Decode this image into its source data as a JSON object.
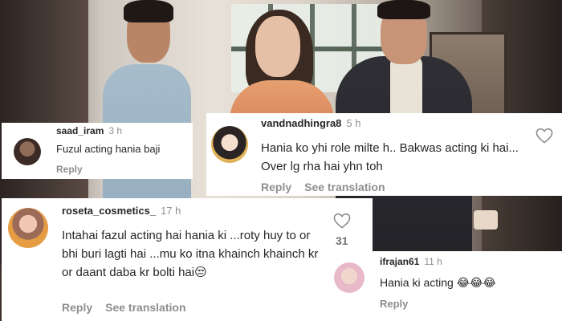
{
  "comments": [
    {
      "username": "saad_iram",
      "time": "3 h",
      "text": "Fuzul acting hania baji",
      "reply_label": "Reply"
    },
    {
      "username": "vandnadhingra8",
      "time": "5 h",
      "text": "Hania ko yhi role milte h.. Bakwas acting ki hai... Over lg rha hai yhn toh",
      "reply_label": "Reply",
      "translate_label": "See translation"
    },
    {
      "username": "roseta_cosmetics_",
      "time": "17 h",
      "text": "Intahai fazul acting hai hania ki ...roty huy to or bhi buri lagti hai ...mu ko itna khainch khainch kr or daant daba kr bolti hai😒",
      "reply_label": "Reply",
      "translate_label": "See translation",
      "likes": "31"
    },
    {
      "username": "ifrajan61",
      "time": "11 h",
      "text": "Hania ki acting 😂😂😂",
      "reply_label": "Reply"
    }
  ],
  "icons": {
    "like": "heart-outline-icon"
  },
  "colors": {
    "username": "#262626",
    "secondary_text": "#8e8e8e",
    "card_background": "#ffffff"
  }
}
